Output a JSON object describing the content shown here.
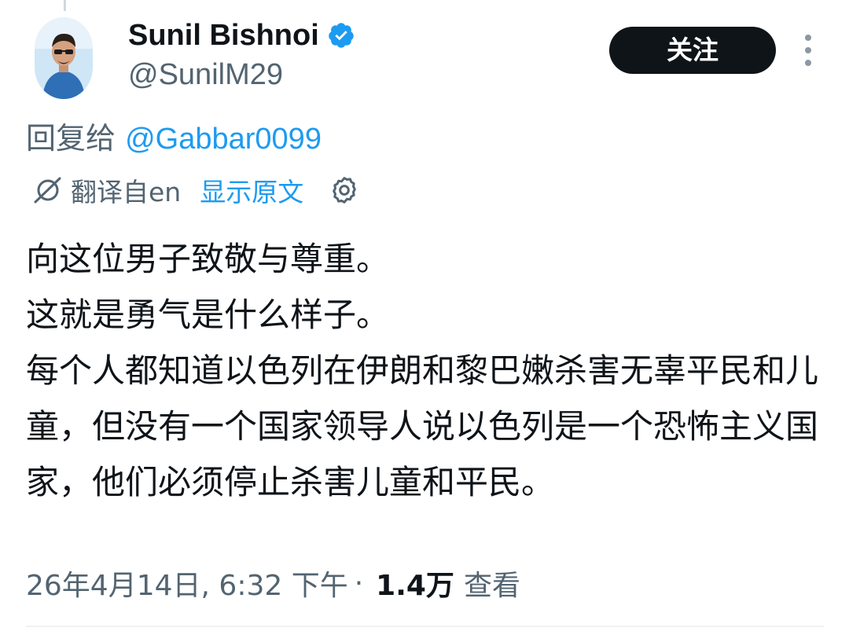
{
  "author": {
    "display_name": "Sunil Bishnoi",
    "handle": "@SunilM29",
    "verified": true
  },
  "actions": {
    "follow_label": "关注"
  },
  "reply": {
    "prefix": "回复给 ",
    "mention": "@Gabbar0099"
  },
  "translation": {
    "translated_from": "翻译自en",
    "show_original": "显示原文"
  },
  "tweet": {
    "text": "向这位男子致敬与尊重。\n这就是勇气是什么样子。\n每个人都知道以色列在伊朗和黎巴嫩杀害无辜平民和儿童，但没有一个国家领导人说以色列是一个恐怖主义国家，他们必须停止杀害儿童和平民。"
  },
  "meta": {
    "timestamp": "26年4月14日, 6:32 下午",
    "separator": "·",
    "views_count": "1.4万",
    "views_label": "查看"
  },
  "colors": {
    "accent": "#1d9bf0",
    "text_primary": "#0f1419",
    "text_secondary": "#536471",
    "button_bg": "#0f1419"
  },
  "icons": {
    "verified": "verified-badge-icon",
    "more": "more-vertical-icon",
    "translate": "translate-icon",
    "settings": "gear-icon"
  }
}
